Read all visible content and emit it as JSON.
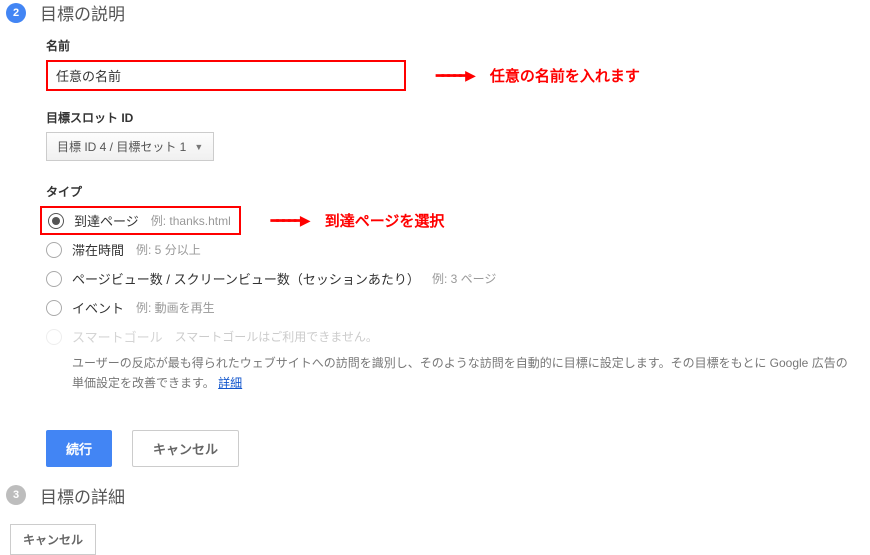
{
  "step2": {
    "number": "2",
    "title": "目標の説明",
    "name_label": "名前",
    "name_value": "任意の名前",
    "name_annotation": "任意の名前を入れます",
    "slot_label": "目標スロット ID",
    "slot_value": "目標 ID 4 / 目標セット 1",
    "type_label": "タイプ",
    "types": {
      "destination": {
        "label": "到達ページ",
        "example": "例: thanks.html",
        "annotation": "到達ページを選択"
      },
      "duration": {
        "label": "滞在時間",
        "example": "例: 5 分以上"
      },
      "pages": {
        "label": "ページビュー数 / スクリーンビュー数（セッションあたり）",
        "example": "例: 3 ページ"
      },
      "event": {
        "label": "イベント",
        "example": "例: 動画を再生"
      },
      "smart": {
        "label": "スマートゴール",
        "unavailable": "スマートゴールはご利用できません。",
        "desc": "ユーザーの反応が最も得られたウェブサイトへの訪問を識別し、そのような訪問を自動的に目標に設定します。その目標をもとに Google 広告の単価設定を改善できます。",
        "link": "詳細"
      }
    },
    "continue_btn": "続行",
    "cancel_btn": "キャンセル"
  },
  "step3": {
    "number": "3",
    "title": "目標の詳細"
  },
  "footer": {
    "cancel": "キャンセル"
  }
}
